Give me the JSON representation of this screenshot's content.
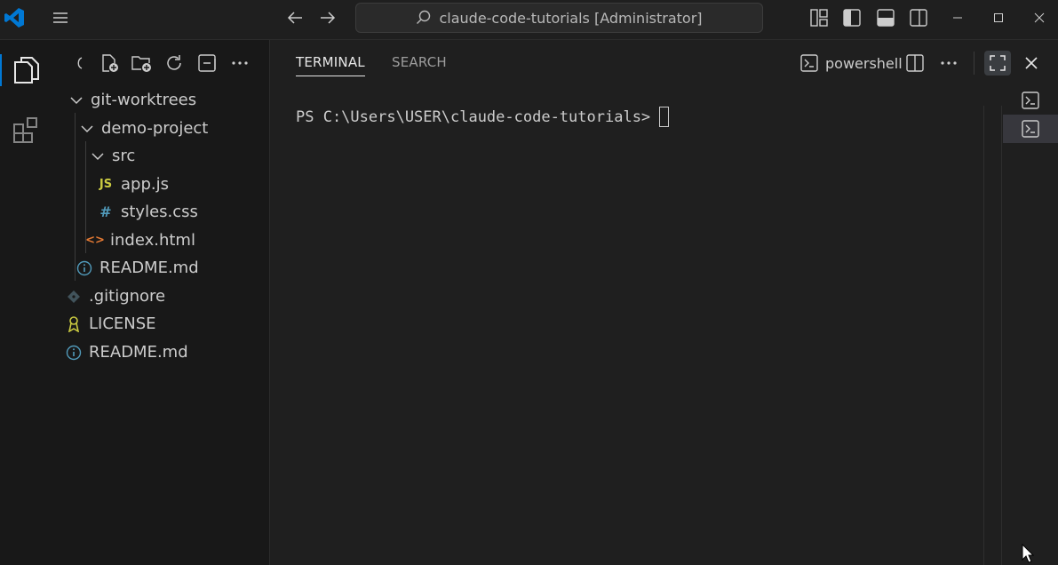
{
  "titlebar": {
    "search_text": "claude-code-tutorials [Administrator]"
  },
  "activity_bar": {
    "items": [
      {
        "icon": "files-icon",
        "label": "Explorer",
        "active": true
      },
      {
        "icon": "extensions-icon",
        "label": "Extensions",
        "active": false
      }
    ]
  },
  "explorer": {
    "tree": [
      {
        "label": "git-worktrees",
        "type": "folder",
        "expanded": true,
        "depth": 0
      },
      {
        "label": "demo-project",
        "type": "folder",
        "expanded": true,
        "depth": 1
      },
      {
        "label": "src",
        "type": "folder",
        "expanded": true,
        "depth": 2
      },
      {
        "label": "app.js",
        "type": "js",
        "icon_text": "JS",
        "depth": 3
      },
      {
        "label": "styles.css",
        "type": "css",
        "icon_text": "#",
        "depth": 3
      },
      {
        "label": "index.html",
        "type": "html",
        "icon_text": "<>",
        "depth": 2
      },
      {
        "label": "README.md",
        "type": "info",
        "depth": 1
      },
      {
        "label": ".gitignore",
        "type": "git",
        "depth": 0
      },
      {
        "label": "LICENSE",
        "type": "license",
        "depth": 0
      },
      {
        "label": "README.md",
        "type": "info",
        "depth": 0
      }
    ]
  },
  "panel": {
    "tabs": [
      {
        "label": "TERMINAL",
        "active": true
      },
      {
        "label": "SEARCH",
        "active": false
      }
    ],
    "terminal_profile": "powershell",
    "prompt": "PS C:\\Users\\USER\\claude-code-tutorials>"
  },
  "colors": {
    "accent": "#0078d4",
    "js": "#cbcb41",
    "css": "#519aba",
    "html": "#e37933",
    "info": "#519aba",
    "license": "#cbcb41",
    "git": "#41535b"
  }
}
